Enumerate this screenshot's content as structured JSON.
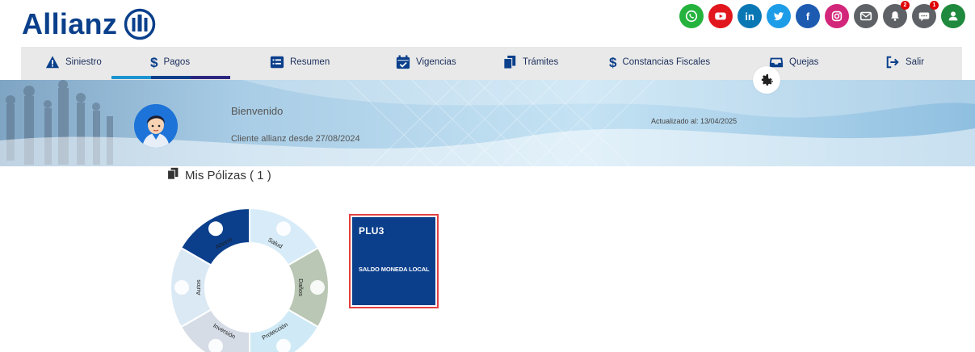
{
  "brand": {
    "name": "Allianz",
    "color": "#0a3f8b"
  },
  "social": [
    {
      "name": "whatsapp-icon",
      "color": "#25b33e"
    },
    {
      "name": "youtube-icon",
      "color": "#e1171d"
    },
    {
      "name": "linkedin-icon",
      "color": "#0a77b5",
      "text": "in"
    },
    {
      "name": "twitter-icon",
      "color": "#1d9ce8"
    },
    {
      "name": "facebook-icon",
      "color": "#1d5bb1",
      "text": "f"
    },
    {
      "name": "instagram-icon",
      "color": "#d2267a"
    },
    {
      "name": "mail-icon",
      "color": "#5e6266"
    },
    {
      "name": "notifications-icon",
      "color": "#5e6266",
      "badge": "2"
    },
    {
      "name": "chat-icon",
      "color": "#5e6266",
      "badge": "1"
    },
    {
      "name": "user-icon",
      "color": "#1f8a3d"
    }
  ],
  "nav": {
    "items": [
      {
        "label": "Siniestro",
        "icon": "warning-icon"
      },
      {
        "label": "Pagos",
        "icon": "dollar-icon"
      },
      {
        "label": "Resumen",
        "icon": "list-icon"
      },
      {
        "label": "Vigencias",
        "icon": "calendar-check-icon"
      },
      {
        "label": "Trámites",
        "icon": "copy-icon"
      },
      {
        "label": "Constancias Fiscales",
        "icon": "dollar-icon"
      },
      {
        "label": "Quejas",
        "icon": "inbox-icon"
      },
      {
        "label": "Salir",
        "icon": "logout-icon"
      }
    ],
    "active_index": 1,
    "settings_icon": "gear-icon"
  },
  "banner": {
    "welcome": "Bienvenido",
    "since": "Cliente allianz desde 27/08/2024",
    "updated": "Actualizado al: 13/04/2025"
  },
  "policies": {
    "title": "Mis Pólizas ( 1 )",
    "wheel": {
      "segments": [
        "Ahorro",
        "Salud",
        "Daños",
        "Protección",
        "Inversión",
        "Autos"
      ],
      "active": "Ahorro"
    },
    "card": {
      "id": "PLU3",
      "label": "SALDO MONEDA LOCAL"
    }
  }
}
